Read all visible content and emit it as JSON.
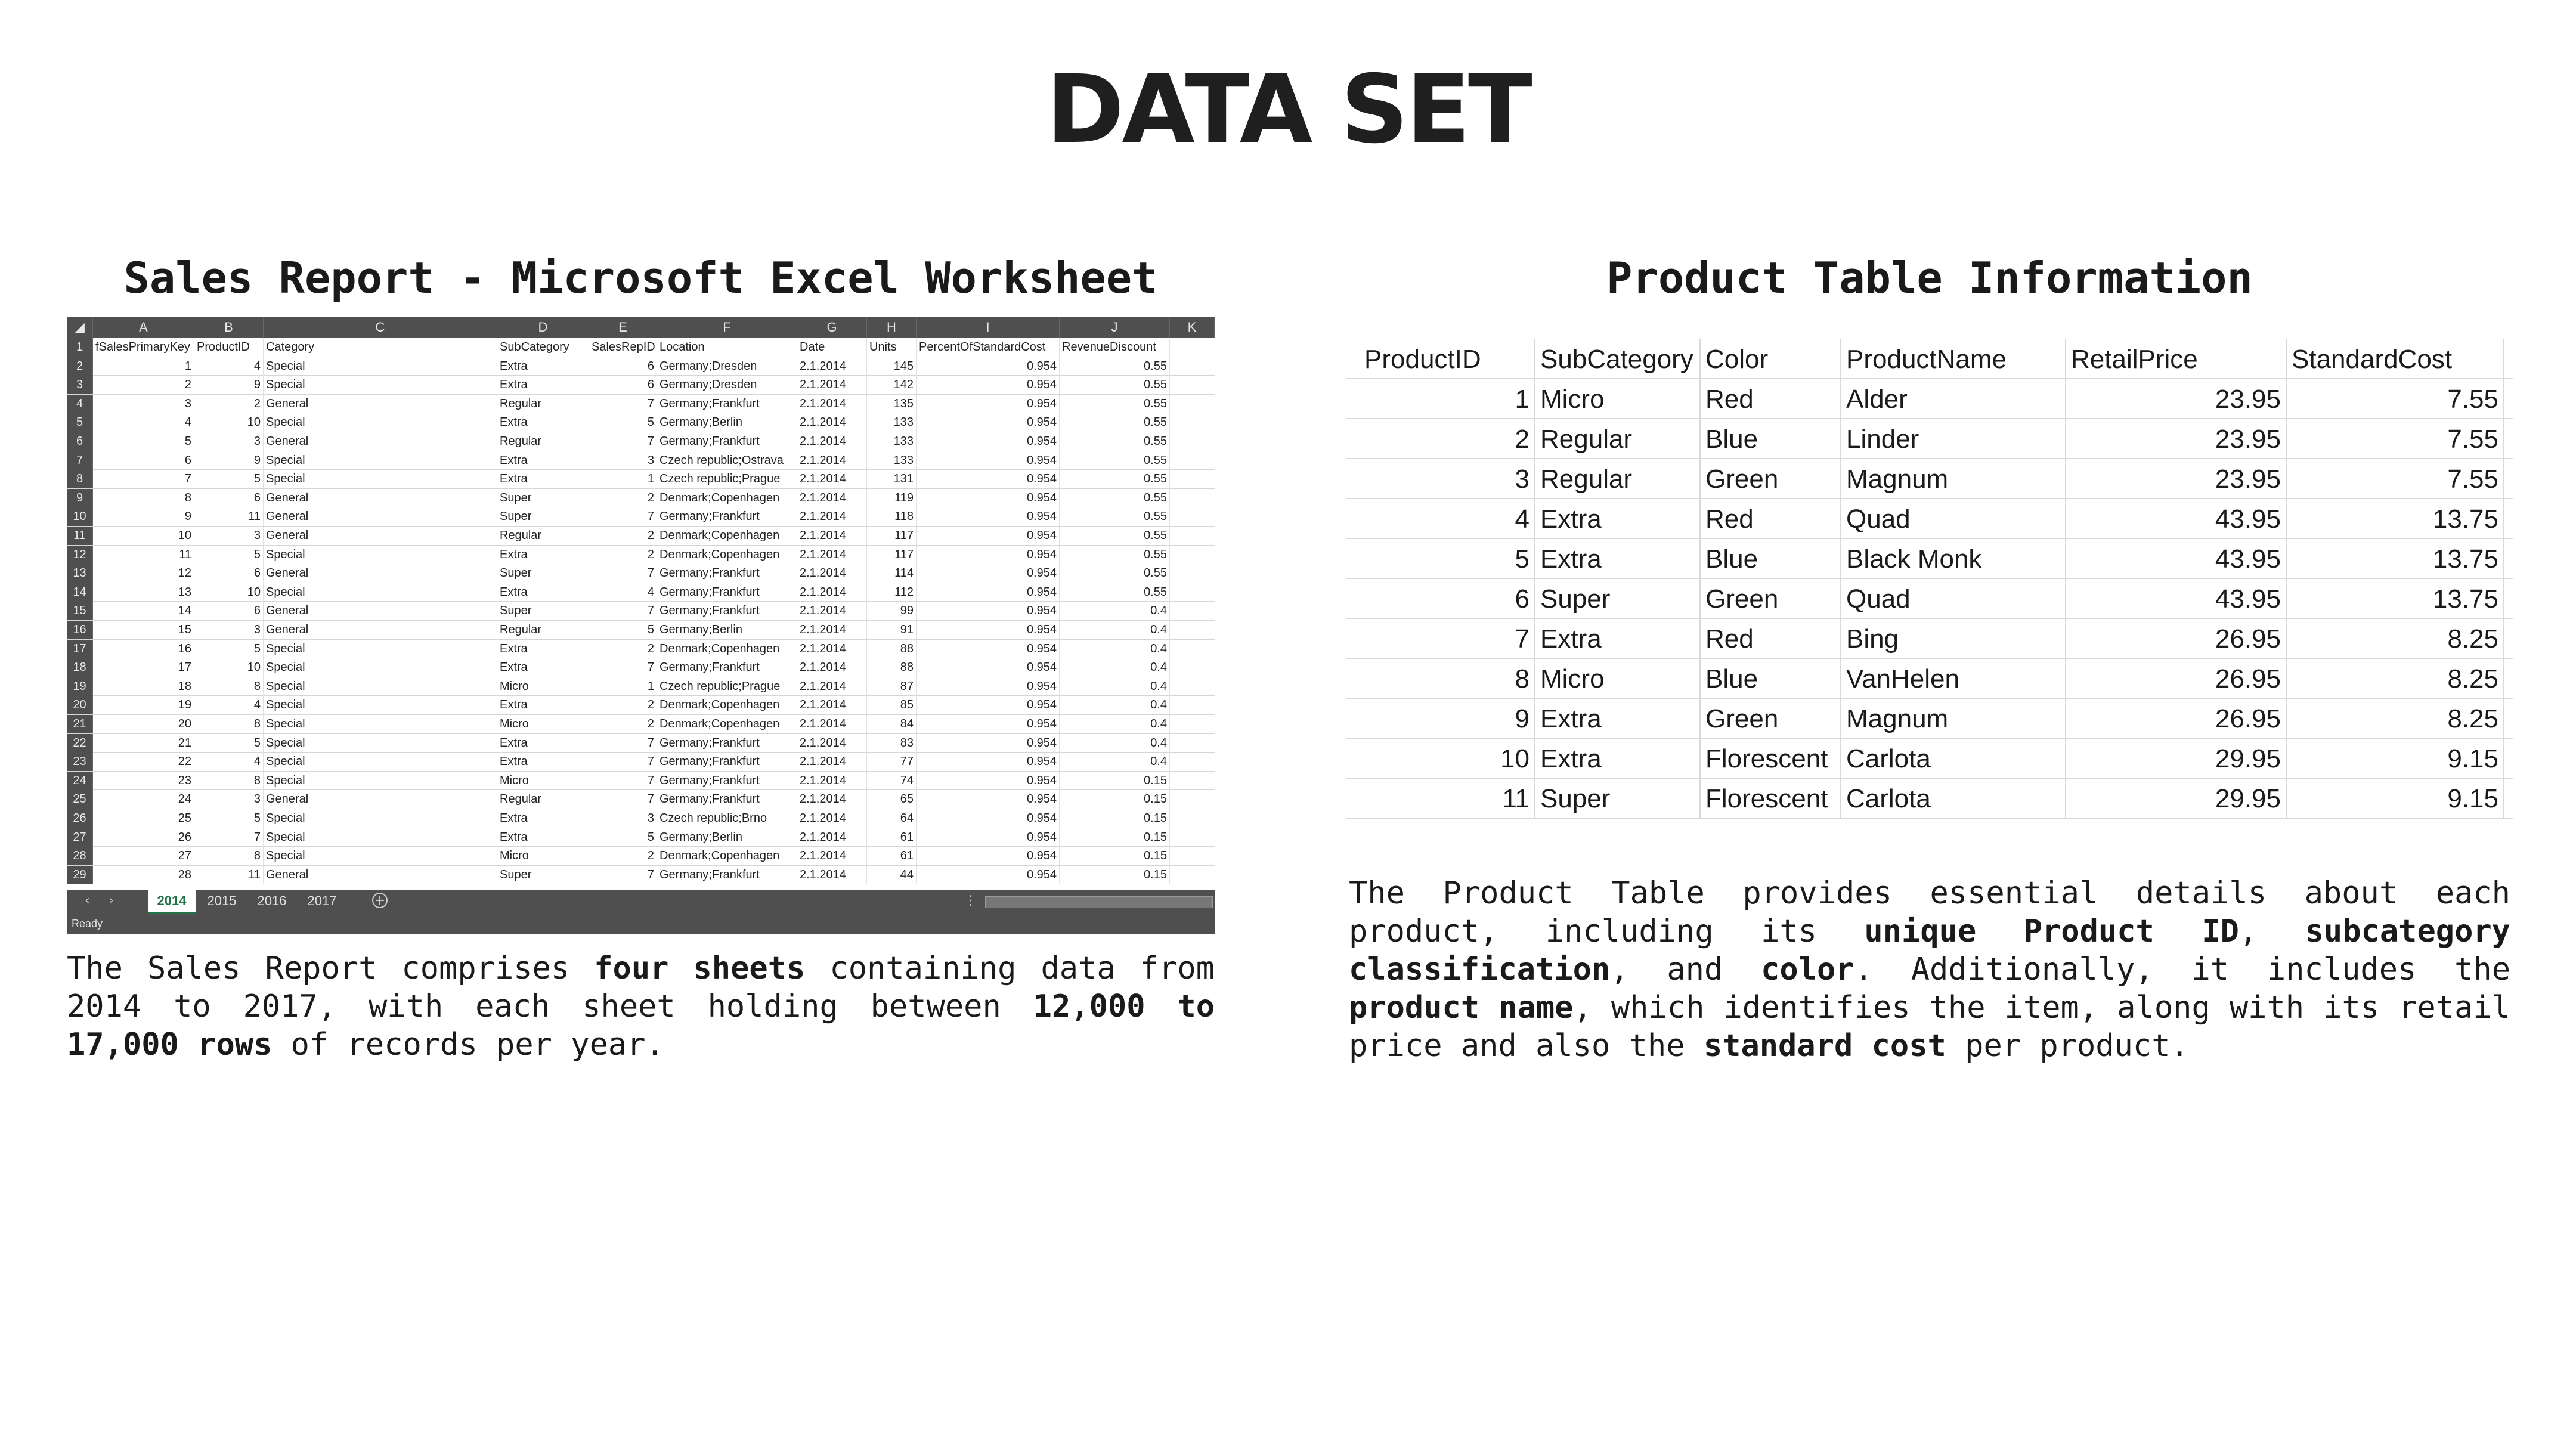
{
  "title": "DATA SET",
  "left": {
    "heading": "Sales Report - Microsoft Excel Worksheet",
    "description": {
      "t1": "The Sales Report comprises ",
      "b1": "four sheets",
      "t2": " containing data from 2014 to 2017, with each sheet holding between ",
      "b2": "12,000 to 17,000 rows",
      "t3": " of records per year."
    },
    "excel": {
      "columns": [
        "A",
        "B",
        "C",
        "D",
        "E",
        "F",
        "G",
        "H",
        "I",
        "J",
        "K"
      ],
      "header": [
        "fSalesPrimaryKey",
        "ProductID",
        "Category",
        "SubCategory",
        "SalesRepID",
        "Location",
        "Date",
        "Units",
        "PercentOfStandardCost",
        "RevenueDiscount"
      ],
      "rows": [
        [
          "1",
          "4",
          "Special",
          "Extra",
          "6",
          "Germany;Dresden",
          "2.1.2014",
          "145",
          "0.954",
          "0.55"
        ],
        [
          "2",
          "9",
          "Special",
          "Extra",
          "6",
          "Germany;Dresden",
          "2.1.2014",
          "142",
          "0.954",
          "0.55"
        ],
        [
          "3",
          "2",
          "General",
          "Regular",
          "7",
          "Germany;Frankfurt",
          "2.1.2014",
          "135",
          "0.954",
          "0.55"
        ],
        [
          "4",
          "10",
          "Special",
          "Extra",
          "5",
          "Germany;Berlin",
          "2.1.2014",
          "133",
          "0.954",
          "0.55"
        ],
        [
          "5",
          "3",
          "General",
          "Regular",
          "7",
          "Germany;Frankfurt",
          "2.1.2014",
          "133",
          "0.954",
          "0.55"
        ],
        [
          "6",
          "9",
          "Special",
          "Extra",
          "3",
          "Czech republic;Ostrava",
          "2.1.2014",
          "133",
          "0.954",
          "0.55"
        ],
        [
          "7",
          "5",
          "Special",
          "Extra",
          "1",
          "Czech republic;Prague",
          "2.1.2014",
          "131",
          "0.954",
          "0.55"
        ],
        [
          "8",
          "6",
          "General",
          "Super",
          "2",
          "Denmark;Copenhagen",
          "2.1.2014",
          "119",
          "0.954",
          "0.55"
        ],
        [
          "9",
          "11",
          "General",
          "Super",
          "7",
          "Germany;Frankfurt",
          "2.1.2014",
          "118",
          "0.954",
          "0.55"
        ],
        [
          "10",
          "3",
          "General",
          "Regular",
          "2",
          "Denmark;Copenhagen",
          "2.1.2014",
          "117",
          "0.954",
          "0.55"
        ],
        [
          "11",
          "5",
          "Special",
          "Extra",
          "2",
          "Denmark;Copenhagen",
          "2.1.2014",
          "117",
          "0.954",
          "0.55"
        ],
        [
          "12",
          "6",
          "General",
          "Super",
          "7",
          "Germany;Frankfurt",
          "2.1.2014",
          "114",
          "0.954",
          "0.55"
        ],
        [
          "13",
          "10",
          "Special",
          "Extra",
          "4",
          "Germany;Frankfurt",
          "2.1.2014",
          "112",
          "0.954",
          "0.55"
        ],
        [
          "14",
          "6",
          "General",
          "Super",
          "7",
          "Germany;Frankfurt",
          "2.1.2014",
          "99",
          "0.954",
          "0.4"
        ],
        [
          "15",
          "3",
          "General",
          "Regular",
          "5",
          "Germany;Berlin",
          "2.1.2014",
          "91",
          "0.954",
          "0.4"
        ],
        [
          "16",
          "5",
          "Special",
          "Extra",
          "2",
          "Denmark;Copenhagen",
          "2.1.2014",
          "88",
          "0.954",
          "0.4"
        ],
        [
          "17",
          "10",
          "Special",
          "Extra",
          "7",
          "Germany;Frankfurt",
          "2.1.2014",
          "88",
          "0.954",
          "0.4"
        ],
        [
          "18",
          "8",
          "Special",
          "Micro",
          "1",
          "Czech republic;Prague",
          "2.1.2014",
          "87",
          "0.954",
          "0.4"
        ],
        [
          "19",
          "4",
          "Special",
          "Extra",
          "2",
          "Denmark;Copenhagen",
          "2.1.2014",
          "85",
          "0.954",
          "0.4"
        ],
        [
          "20",
          "8",
          "Special",
          "Micro",
          "2",
          "Denmark;Copenhagen",
          "2.1.2014",
          "84",
          "0.954",
          "0.4"
        ],
        [
          "21",
          "5",
          "Special",
          "Extra",
          "7",
          "Germany;Frankfurt",
          "2.1.2014",
          "83",
          "0.954",
          "0.4"
        ],
        [
          "22",
          "4",
          "Special",
          "Extra",
          "7",
          "Germany;Frankfurt",
          "2.1.2014",
          "77",
          "0.954",
          "0.4"
        ],
        [
          "23",
          "8",
          "Special",
          "Micro",
          "7",
          "Germany;Frankfurt",
          "2.1.2014",
          "74",
          "0.954",
          "0.15"
        ],
        [
          "24",
          "3",
          "General",
          "Regular",
          "7",
          "Germany;Frankfurt",
          "2.1.2014",
          "65",
          "0.954",
          "0.15"
        ],
        [
          "25",
          "5",
          "Special",
          "Extra",
          "3",
          "Czech republic;Brno",
          "2.1.2014",
          "64",
          "0.954",
          "0.15"
        ],
        [
          "26",
          "7",
          "Special",
          "Extra",
          "5",
          "Germany;Berlin",
          "2.1.2014",
          "61",
          "0.954",
          "0.15"
        ],
        [
          "27",
          "8",
          "Special",
          "Micro",
          "2",
          "Denmark;Copenhagen",
          "2.1.2014",
          "61",
          "0.954",
          "0.15"
        ],
        [
          "28",
          "11",
          "General",
          "Super",
          "7",
          "Germany;Frankfurt",
          "2.1.2014",
          "44",
          "0.954",
          "0.15"
        ]
      ],
      "sheets": [
        "2014",
        "2015",
        "2016",
        "2017"
      ],
      "active_sheet": "2014",
      "status": "Ready"
    }
  },
  "right": {
    "heading": "Product Table Information",
    "description": {
      "t1": "The Product Table provides essential details about each product, including its ",
      "b1": "unique Product ID",
      "t2": ", ",
      "b2": "subcategory classification",
      "t3": ", and ",
      "b3": "color",
      "t4": ". Additionally, it includes the ",
      "b4": "product name",
      "t5": ", which identifies the item, along with its retail price and also the ",
      "b5": "standard cost",
      "t6": " per product."
    },
    "table": {
      "header": [
        "ProductID",
        "SubCategory",
        "Color",
        "ProductName",
        "RetailPrice",
        "StandardCost"
      ],
      "rows": [
        [
          "1",
          "Micro",
          "Red",
          "Alder",
          "23.95",
          "7.55"
        ],
        [
          "2",
          "Regular",
          "Blue",
          "Linder",
          "23.95",
          "7.55"
        ],
        [
          "3",
          "Regular",
          "Green",
          "Magnum",
          "23.95",
          "7.55"
        ],
        [
          "4",
          "Extra",
          "Red",
          "Quad",
          "43.95",
          "13.75"
        ],
        [
          "5",
          "Extra",
          "Blue",
          "Black Monk",
          "43.95",
          "13.75"
        ],
        [
          "6",
          "Super",
          "Green",
          "Quad",
          "43.95",
          "13.75"
        ],
        [
          "7",
          "Extra",
          "Red",
          "Bing",
          "26.95",
          "8.25"
        ],
        [
          "8",
          "Micro",
          "Blue",
          "VanHelen",
          "26.95",
          "8.25"
        ],
        [
          "9",
          "Extra",
          "Green",
          "Magnum",
          "26.95",
          "8.25"
        ],
        [
          "10",
          "Extra",
          "Florescent",
          "Carlota",
          "29.95",
          "9.15"
        ],
        [
          "11",
          "Super",
          "Florescent",
          "Carlota",
          "29.95",
          "9.15"
        ]
      ]
    }
  }
}
